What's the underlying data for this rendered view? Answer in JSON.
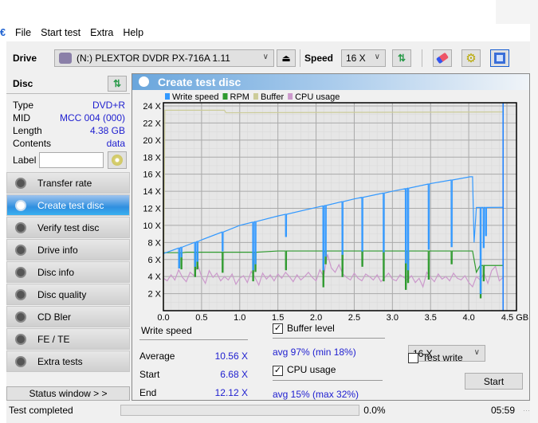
{
  "menu": [
    "File",
    "Start test",
    "Extra",
    "Help"
  ],
  "toolbar": {
    "drive_label": "Drive",
    "drive_value": "(N:)  PLEXTOR DVDR   PX-716A 1.11",
    "speed_label": "Speed",
    "speed_value": "16 X"
  },
  "disc": {
    "title": "Disc",
    "rows": [
      {
        "k": "Type",
        "v": "DVD+R"
      },
      {
        "k": "MID",
        "v": "MCC 004 (000)"
      },
      {
        "k": "Length",
        "v": "4.38 GB"
      },
      {
        "k": "Contents",
        "v": "data"
      }
    ],
    "label_label": "Label",
    "label_value": ""
  },
  "nav": [
    "Transfer rate",
    "Create test disc",
    "Verify test disc",
    "Drive info",
    "Disc info",
    "Disc quality",
    "CD Bler",
    "FE / TE",
    "Extra tests"
  ],
  "nav_active": 1,
  "status_window": "Status window > >",
  "panel": {
    "title": "Create test disc"
  },
  "stats": {
    "write_speed": "Write speed",
    "average_label": "Average",
    "average": "10.56 X",
    "start_label": "Start",
    "start": "6.68 X",
    "end_label": "End",
    "end": "12.12 X",
    "buffer_label": "Buffer level",
    "buffer_checked": true,
    "buffer_stat": "avg 97% (min 18%)",
    "cpu_label": "CPU usage",
    "cpu_checked": true,
    "cpu_stat": "avg 15% (max 32%)",
    "speed_select": "16 X",
    "test_write_label": "Test write",
    "test_write_checked": false,
    "start_button": "Start"
  },
  "statusbar": {
    "text": "Test completed",
    "progress": "0.0%",
    "time": "05:59"
  },
  "chart_data": {
    "type": "line",
    "legend": [
      "Write speed",
      "RPM",
      "Buffer",
      "CPU usage"
    ],
    "colors": {
      "Write speed": "#3399ff",
      "RPM": "#2e9a2e",
      "Buffer": "#cccc99",
      "CPU usage": "#cc99cc",
      "position": "#1a7fff"
    },
    "xlim": [
      0,
      4.5
    ],
    "ylim": [
      0,
      24
    ],
    "x_ticks": [
      "0.0",
      "0.5",
      "1.0",
      "1.5",
      "2.0",
      "2.5",
      "3.0",
      "3.5",
      "4.0",
      "4.5 GB"
    ],
    "y_ticks": [
      "2 X",
      "4 X",
      "6 X",
      "8 X",
      "10 X",
      "12 X",
      "14 X",
      "16 X",
      "18 X",
      "20 X",
      "22 X",
      "24 X"
    ],
    "grid": true,
    "position_marker": 4.45,
    "write_speed": [
      [
        0,
        6.7
      ],
      [
        0.5,
        8.3
      ],
      [
        1.0,
        10.0
      ],
      [
        1.5,
        11.1
      ],
      [
        2.0,
        12.1
      ],
      [
        2.5,
        13.1
      ],
      [
        3.0,
        14.0
      ],
      [
        3.5,
        14.9
      ],
      [
        4.02,
        15.7
      ],
      [
        4.05,
        15.7
      ],
      [
        4.07,
        8
      ],
      [
        4.1,
        12.1
      ],
      [
        4.45,
        12.12
      ]
    ],
    "write_dips": [
      [
        0.2,
        5.0
      ],
      [
        0.23,
        6.3
      ],
      [
        0.41,
        5.2
      ],
      [
        0.44,
        5.8
      ],
      [
        0.77,
        7.0
      ],
      [
        1.17,
        4.8
      ],
      [
        1.2,
        5.5
      ],
      [
        1.6,
        8.7
      ],
      [
        2.09,
        4.8
      ],
      [
        2.12,
        6.4
      ],
      [
        2.34,
        6.6
      ],
      [
        2.6,
        7.0
      ],
      [
        2.88,
        6.9
      ],
      [
        3.17,
        5.6
      ],
      [
        3.2,
        4.8
      ],
      [
        3.47,
        7.2
      ],
      [
        3.77,
        7.5
      ],
      [
        4.15,
        2.0
      ],
      [
        4.19,
        7.4
      ],
      [
        4.22,
        8.8
      ]
    ],
    "rpm_base": [
      [
        0,
        6.8
      ],
      [
        0.25,
        6.8
      ],
      [
        0.3,
        6.85
      ],
      [
        1.2,
        6.85
      ],
      [
        1.5,
        7.0
      ],
      [
        4.05,
        7.0
      ],
      [
        4.1,
        4.5
      ],
      [
        4.15,
        5.3
      ],
      [
        4.45,
        5.3
      ]
    ],
    "rpm_dips": [
      [
        0.2,
        5.0
      ],
      [
        0.23,
        4.9
      ],
      [
        0.41,
        4.0
      ],
      [
        0.44,
        4.9
      ],
      [
        0.77,
        4.5
      ],
      [
        1.17,
        3.5
      ],
      [
        1.2,
        4.6
      ],
      [
        1.6,
        4.8
      ],
      [
        2.09,
        2.8
      ],
      [
        2.12,
        5.5
      ],
      [
        2.34,
        4.0
      ],
      [
        2.6,
        5.2
      ],
      [
        2.88,
        3.5
      ],
      [
        3.17,
        2.5
      ],
      [
        3.2,
        3.3
      ],
      [
        3.47,
        3.7
      ],
      [
        3.77,
        5.5
      ],
      [
        4.15,
        1.5
      ],
      [
        4.19,
        3.5
      ]
    ],
    "buffer": [
      [
        0,
        0
      ],
      [
        0.02,
        23.5
      ],
      [
        0.8,
        23.5
      ],
      [
        0.82,
        23.2
      ],
      [
        4.45,
        23.3
      ]
    ],
    "cpu": [
      3.8,
      3.5,
      4.2,
      3.6,
      4.8,
      3.9,
      3.4,
      4.5,
      4.1,
      5.4,
      4.0,
      3.2,
      4.7,
      3.9,
      4.4,
      3.5,
      4.0,
      3.6,
      4.3,
      3.1,
      3.8,
      4.1,
      3.3,
      4.6,
      3.9,
      3.0,
      4.4,
      3.7,
      4.2,
      3.5,
      4.3,
      3.8,
      4.5,
      4.0,
      3.4,
      4.2,
      3.6,
      4.0,
      4.5,
      3.9,
      3.5,
      4.8,
      4.0,
      6.6,
      5.0,
      4.5,
      5.4,
      4.3,
      3.9,
      3.6,
      4.4,
      3.8,
      3.5,
      4.3,
      4.0,
      3.6,
      4.2,
      3.4,
      3.9,
      4.4,
      3.7,
      3.5,
      4.2,
      3.9,
      3.6,
      4.1,
      3.3,
      3.8,
      2.8,
      4.5,
      3.9,
      3.4,
      4.3,
      3.7,
      4.0,
      3.5,
      4.4,
      3.8,
      3.6,
      4.1,
      3.3,
      2.8,
      4.0,
      3.6,
      4.4,
      3.2,
      4.7,
      5.2,
      3.5,
      3.9
    ]
  }
}
